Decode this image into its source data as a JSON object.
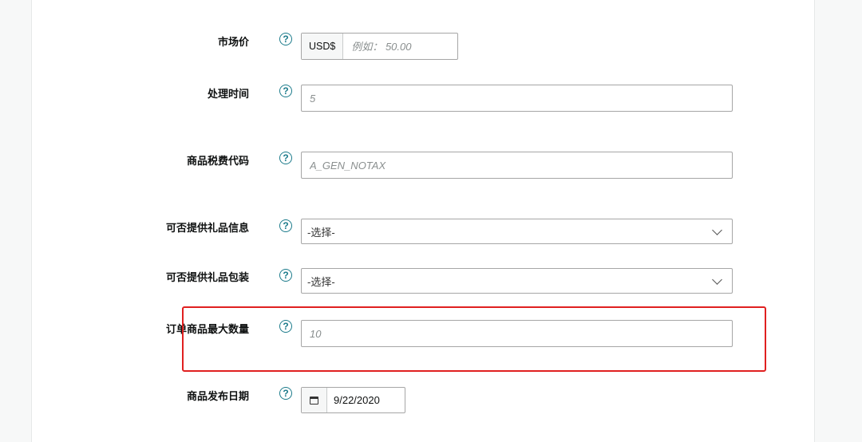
{
  "help_glyph": "?",
  "fields": {
    "market_price": {
      "label": "市场价",
      "currency": "USD$",
      "placeholder": "例如： 50.00"
    },
    "processing_time": {
      "label": "处理时间",
      "placeholder": "5"
    },
    "tax_code": {
      "label": "商品税费代码",
      "placeholder": "A_GEN_NOTAX"
    },
    "gift_message": {
      "label": "可否提供礼品信息",
      "selected": "-选择-"
    },
    "gift_wrap": {
      "label": "可否提供礼品包装",
      "selected": "-选择-"
    },
    "max_order_qty": {
      "label": "订单商品最大数量",
      "placeholder": "10"
    },
    "release_date": {
      "label": "商品发布日期",
      "value": "9/22/2020"
    }
  },
  "colors": {
    "help_icon": "#1c7b8b",
    "highlight_border": "#e02020"
  },
  "icons": {
    "help": "question-circle-icon",
    "dropdown": "chevron-down-icon",
    "date": "calendar-icon"
  }
}
